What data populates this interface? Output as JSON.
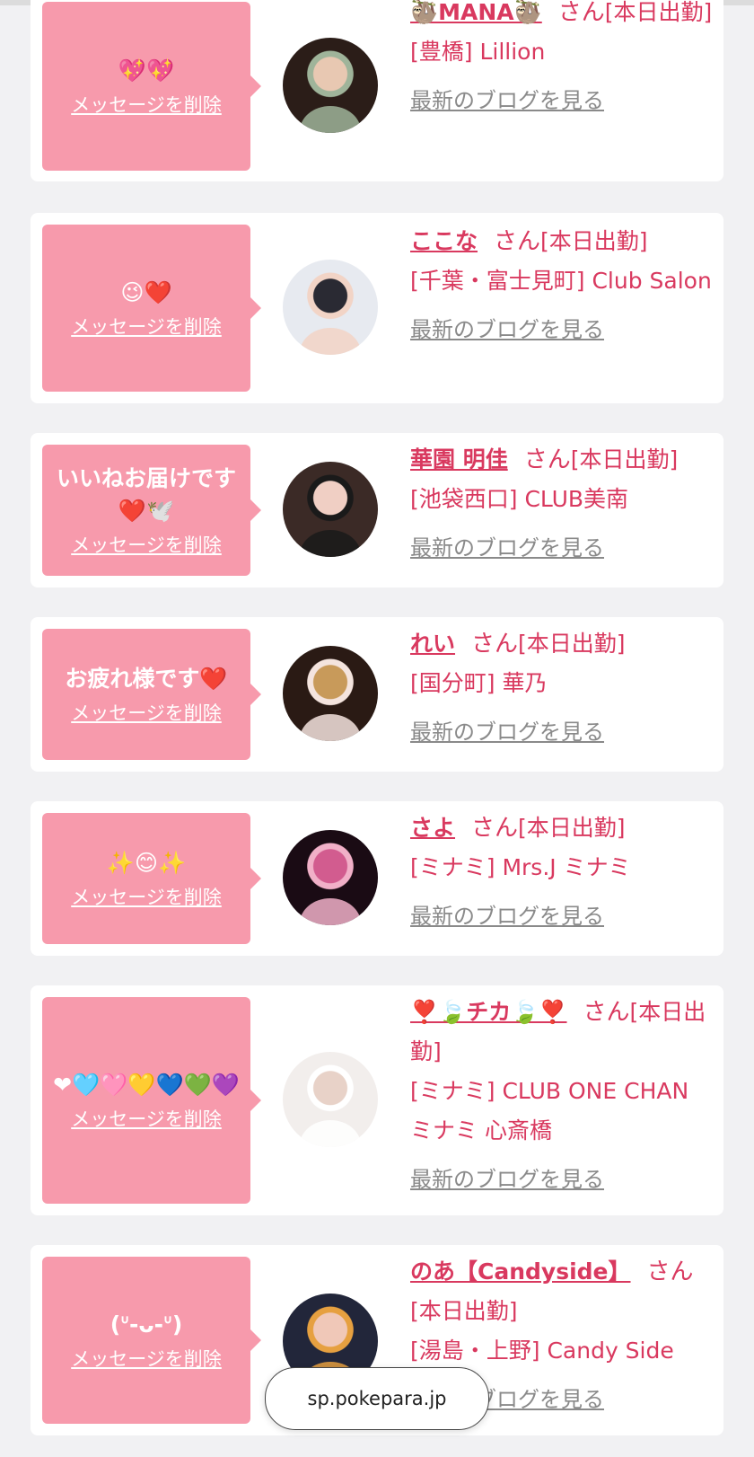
{
  "delete_label": "メッセージを削除",
  "san_label": "さん",
  "blog_label": "最新のブログを見る",
  "url_label": "sp.pokepara.jp",
  "cards": [
    {
      "message": "💖💖",
      "name": "🦥MANA🦥",
      "status": "[本日出勤]",
      "shop": "[豊橋] Lillion",
      "avatar_colors": [
        "#2b1d18",
        "#e8c8b2",
        "#9fb49a"
      ]
    },
    {
      "message": "😉❤️",
      "name": "ここな",
      "status": "[本日出勤]",
      "shop": "[千葉・富士見町] Club Salon",
      "avatar_colors": [
        "#e7eaf0",
        "#2a2a33",
        "#f2d4c6"
      ]
    },
    {
      "message": "いいねお届けです❤️🕊️",
      "name": "華園 明佳",
      "status": "[本日出勤]",
      "shop": "[池袋西口] CLUB美南",
      "avatar_colors": [
        "#3b2a26",
        "#f0cfc4",
        "#1a1a1a"
      ]
    },
    {
      "message": "お疲れ様です❤️",
      "name": "れい",
      "status": "[本日出勤]",
      "shop": "[国分町] 華乃",
      "avatar_colors": [
        "#2a1a14",
        "#c89a5a",
        "#f4e4de"
      ]
    },
    {
      "message": "✨😊✨",
      "name": "さよ",
      "status": "[本日出勤]",
      "shop": "[ミナミ] Mrs.J ミナミ",
      "avatar_colors": [
        "#1a0b14",
        "#d25c8f",
        "#f1b0c8"
      ]
    },
    {
      "message": "❤🩵🩷💛💙💚💜",
      "name": "❣️🍃チカ🍃❣️",
      "status": "[本日出勤]",
      "shop": "[ミナミ] CLUB ONE CHAN ミナミ 心斎橋",
      "avatar_colors": [
        "#f2eeec",
        "#e8d2c8",
        "#ffffff"
      ]
    },
    {
      "message": "(ᐡ-ᴗ-ᐡ)",
      "name": "のあ【Candyside】",
      "status": "[本日出勤]",
      "shop": "[湯島・上野] Candy Side",
      "avatar_colors": [
        "#22263a",
        "#f0c8b8",
        "#e6a040"
      ]
    }
  ]
}
